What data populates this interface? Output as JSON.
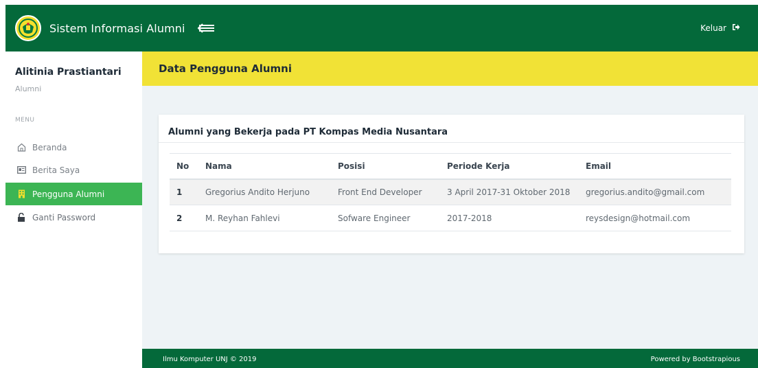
{
  "navbar": {
    "brand": "Sistem Informasi Alumni",
    "logout_label": "Keluar",
    "colors": {
      "navbar": "#04693a",
      "logo_bg": "#f5e02c"
    },
    "icons": {
      "logo": "university-seal-icon",
      "toggle": "sidebar-toggle-arrow-icon",
      "logout": "sign-out-icon"
    }
  },
  "sidebar": {
    "user_name": "Alitinia Prastiantari",
    "user_role": "Alumni",
    "menu_heading": "MENU",
    "items": [
      {
        "label": "Beranda",
        "icon": "home-icon",
        "active": false
      },
      {
        "label": "Berita Saya",
        "icon": "newspaper-icon",
        "active": false
      },
      {
        "label": "Pengguna Alumni",
        "icon": "building-icon",
        "active": true
      },
      {
        "label": "Ganti Password",
        "icon": "unlock-icon",
        "active": false
      }
    ],
    "active_color": "#3cb554"
  },
  "main": {
    "page_title": "Data Pengguna Alumni",
    "header_color": "#f1e236",
    "card": {
      "title": "Alumni yang Bekerja pada PT Kompas Media Nusantara",
      "columns": [
        "No",
        "Nama",
        "Posisi",
        "Periode Kerja",
        "Email"
      ],
      "rows": [
        [
          "1",
          "Gregorius Andito Herjuno",
          "Front End Developer",
          "3 April 2017-31 Oktober 2018",
          "gregorius.andito@gmail.com"
        ],
        [
          "2",
          "M. Reyhan Fahlevi",
          "Sofware Engineer",
          "2017-2018",
          "reysdesign@hotmail.com"
        ]
      ]
    }
  },
  "footer": {
    "left": "Ilmu Komputer UNJ © 2019",
    "right": "Powered by Bootstrapious"
  }
}
